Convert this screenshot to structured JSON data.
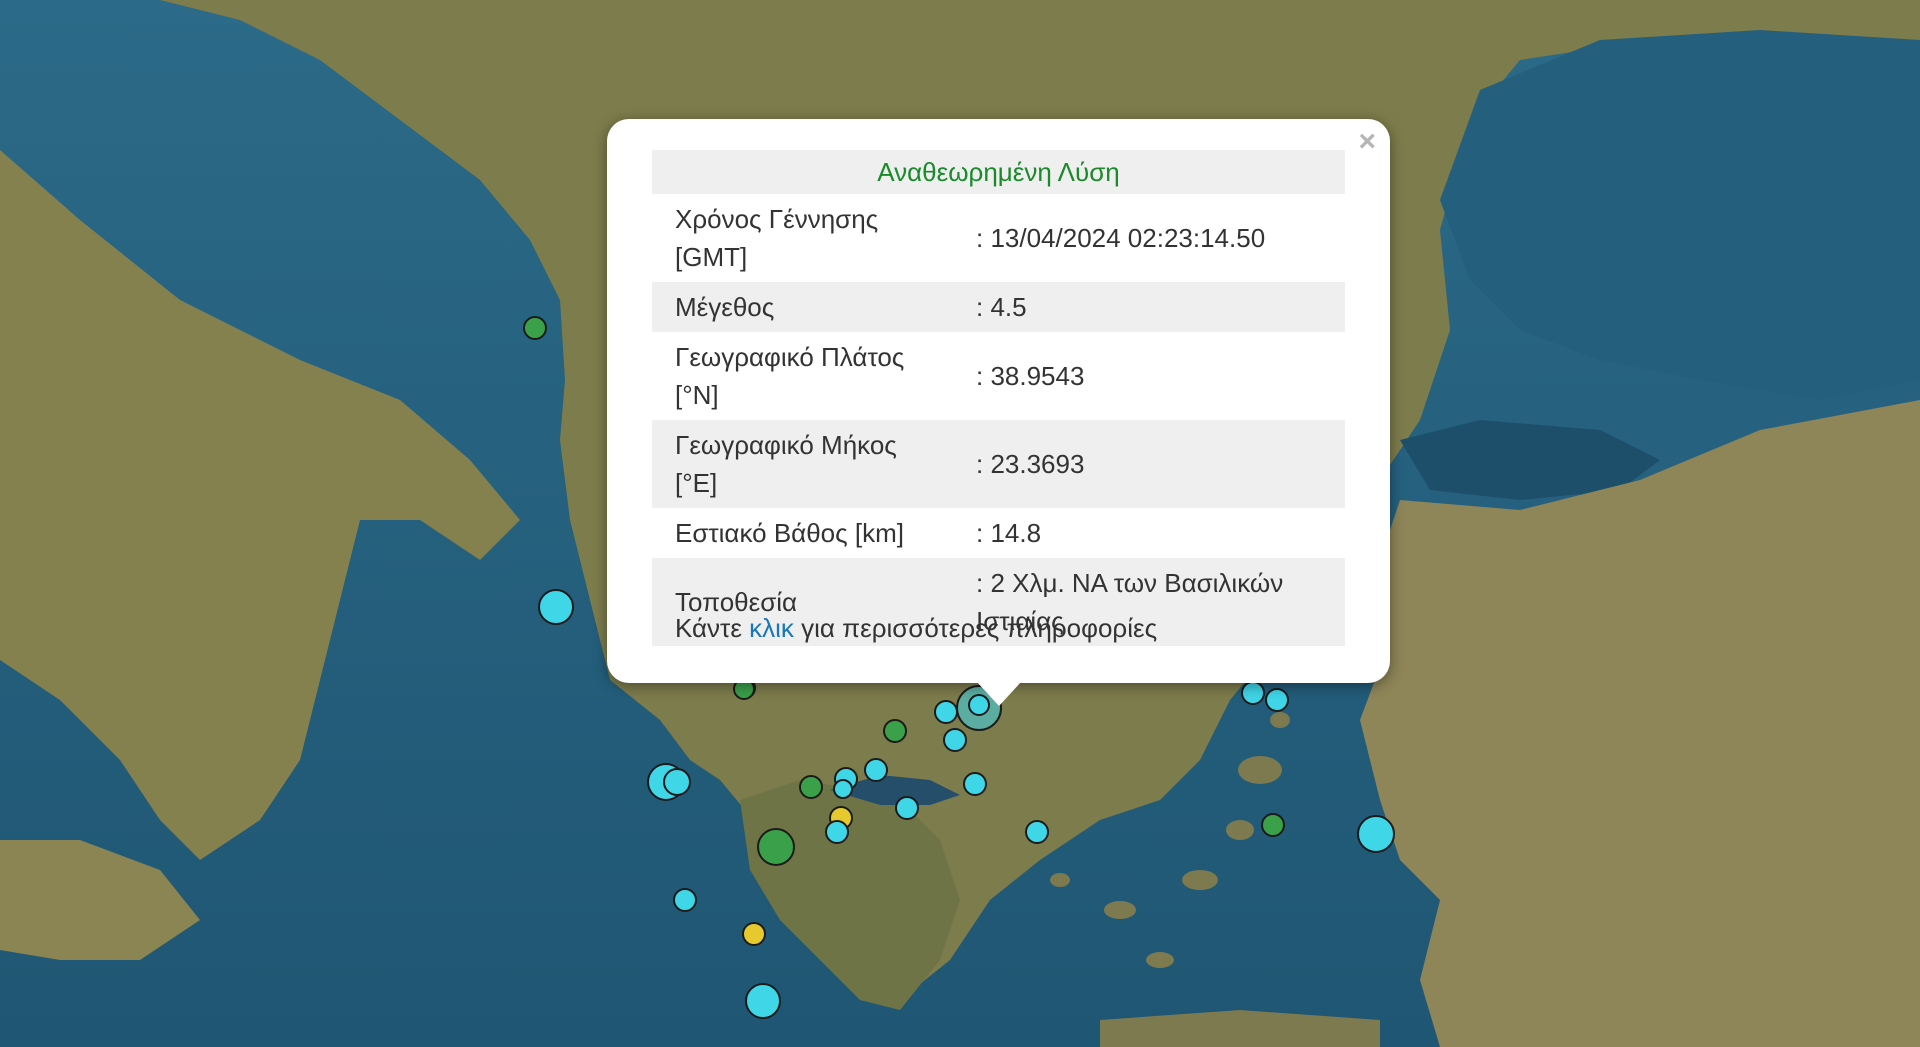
{
  "popup": {
    "header": "Αναθεωρημένη Λύση",
    "close_label": "×",
    "rows": [
      {
        "label": "Χρόνος Γέννησης [GMT]",
        "value": ": 13/04/2024 02:23:14.50"
      },
      {
        "label": "Μέγεθος",
        "value": ": 4.5"
      },
      {
        "label": "Γεωγραφικό Πλάτος [°N]",
        "value": ": 38.9543"
      },
      {
        "label": "Γεωγραφικό Μήκος [°E]",
        "value": ": 23.3693"
      },
      {
        "label": "Εστιακό Βάθος [km]",
        "value": ": 14.8"
      },
      {
        "label": "Τοποθεσία",
        "value": ": 2 Χλμ. ΝΑ των Βασιλικών Ιστιαίας"
      }
    ],
    "more_before": "Κάντε ",
    "more_link": "κλικ",
    "more_after": " για περισσότερες πληροφορίες"
  },
  "colors": {
    "sea": "#2d6f8f",
    "land": "#8a8a5a",
    "marker_cyan": "#3fd6e8",
    "marker_green": "#3aa04a",
    "marker_yellow": "#e5c92e",
    "header_green": "#1a8a2a",
    "link_blue": "#1a77b7"
  }
}
